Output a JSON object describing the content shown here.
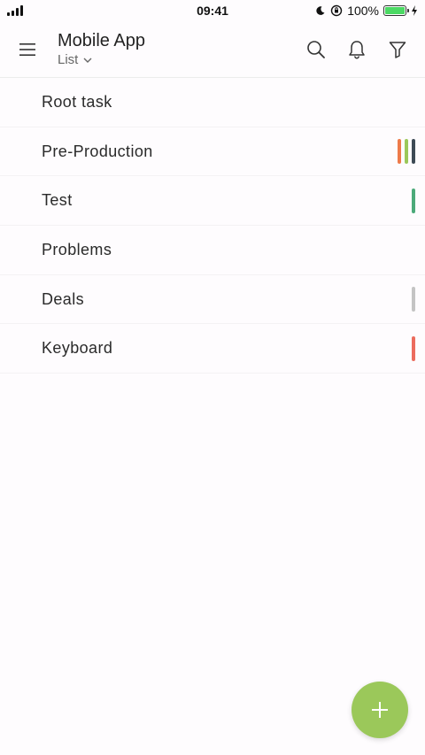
{
  "status_bar": {
    "time": "09:41",
    "battery_percent": "100%",
    "battery_color": "#4cd964"
  },
  "header": {
    "title": "Mobile App",
    "view_label": "List",
    "icons": [
      "menu-icon",
      "search-icon",
      "bell-icon",
      "filter-icon"
    ]
  },
  "tasks": [
    {
      "label": "Root task",
      "markers": []
    },
    {
      "label": "Pre-Production",
      "markers": [
        "#ee7a4a",
        "#9bc85a",
        "#3d4a55"
      ]
    },
    {
      "label": "Test",
      "markers": [
        "#4caa7a"
      ]
    },
    {
      "label": "Problems",
      "markers": []
    },
    {
      "label": "Deals",
      "markers": [
        "#c4c4c4"
      ]
    },
    {
      "label": "Keyboard",
      "markers": [
        "#ec6c5e"
      ]
    }
  ],
  "fab": {
    "icon": "plus-icon",
    "color": "#9bc85a"
  }
}
